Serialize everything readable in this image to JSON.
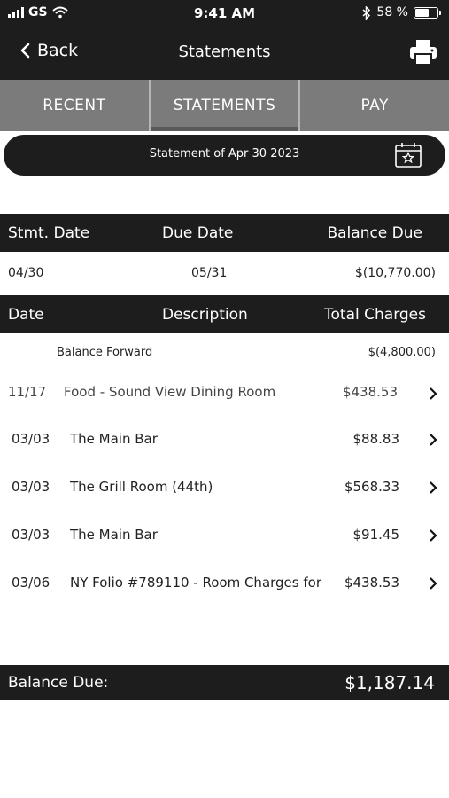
{
  "status_bar": {
    "carrier": "GS",
    "time": "9:41 AM",
    "battery": "58 %",
    "battery_level": 0.58
  },
  "nav": {
    "back_label": "Back",
    "title": "Statements"
  },
  "tabs": [
    {
      "label": "RECENT",
      "active": false
    },
    {
      "label": "STATEMENTS",
      "active": true
    },
    {
      "label": "PAY",
      "active": false
    }
  ],
  "statement_picker": {
    "label": "Statement of Apr 30 2023"
  },
  "summary": {
    "headers": {
      "stmt_date": "Stmt. Date",
      "due_date": "Due Date",
      "balance_due": "Balance Due"
    },
    "values": {
      "stmt_date": "04/30",
      "due_date": "05/31",
      "balance_due": "$(10,770.00)"
    }
  },
  "transactions_table": {
    "headers": {
      "date": "Date",
      "description": "Description",
      "total_charges": "Total Charges"
    },
    "balance_forward": {
      "label": "Balance Forward",
      "amount": "$(4,800.00)"
    },
    "rows": [
      {
        "date": "11/17",
        "description": "Food - Sound View Dining Room",
        "amount": "$438.53"
      },
      {
        "date": "03/03",
        "description": "The Main Bar",
        "amount": "$88.83"
      },
      {
        "date": "03/03",
        "description": "The Grill Room (44th)",
        "amount": "$568.33"
      },
      {
        "date": "03/03",
        "description": "The Main Bar",
        "amount": "$91.45"
      },
      {
        "date": "03/06",
        "description": "NY Folio #789110 - Room Charges for",
        "amount": "$438.53"
      }
    ]
  },
  "footer": {
    "label": "Balance Due:",
    "amount": "$1,187.14"
  },
  "icons": {
    "back": "chevron-left-icon",
    "print": "printer-icon",
    "calendar": "calendar-star-icon",
    "row_chevron": "chevron-right-icon",
    "wifi": "wifi-icon",
    "bluetooth": "bluetooth-icon",
    "battery": "battery-icon",
    "signal": "signal-icon"
  },
  "colors": {
    "dark_bar": "#1d1d1d",
    "tab_bar": "#7b7b7b",
    "text": "#222222"
  }
}
